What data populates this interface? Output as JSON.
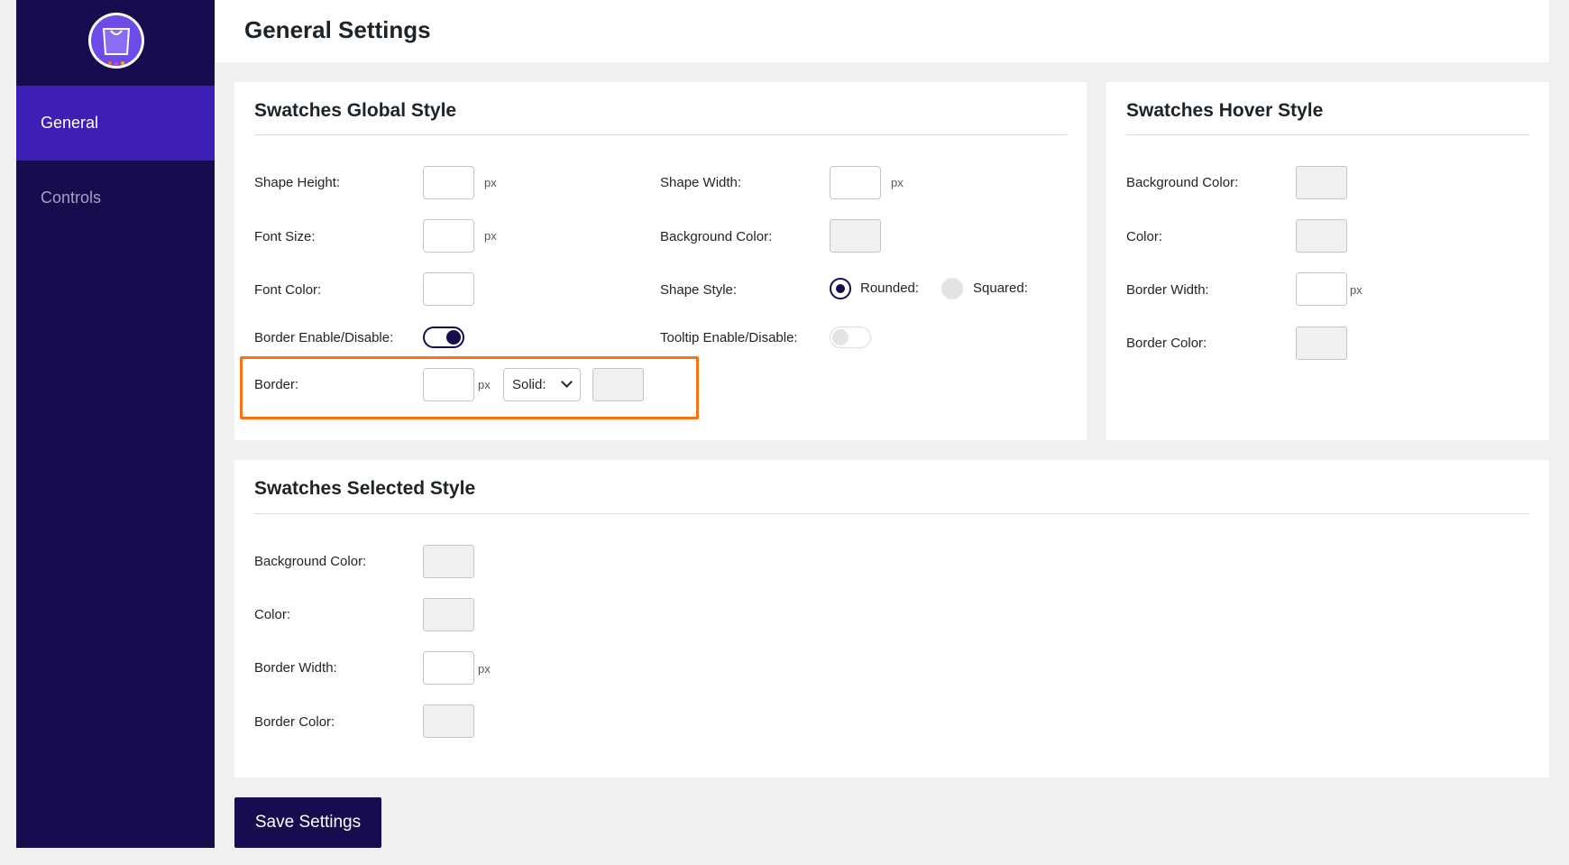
{
  "sidebar": {
    "logo_icon": "shopping-bag-icon",
    "items": [
      {
        "label": "General",
        "active": true
      },
      {
        "label": "Controls",
        "active": false
      }
    ]
  },
  "header": {
    "title": "General Settings"
  },
  "global_style": {
    "title": "Swatches Global Style",
    "shape_height": {
      "label": "Shape Height:",
      "value": "",
      "unit": "px"
    },
    "shape_width": {
      "label": "Shape Width:",
      "value": "",
      "unit": "px"
    },
    "font_size": {
      "label": "Font Size:",
      "value": "",
      "unit": "px"
    },
    "background_color": {
      "label": "Background Color:"
    },
    "font_color": {
      "label": "Font Color:"
    },
    "shape_style": {
      "label": "Shape Style:",
      "options": [
        "Rounded:",
        "Squared:"
      ],
      "selected": "Rounded:"
    },
    "border_toggle": {
      "label": "Border Enable/Disable:",
      "on": true
    },
    "tooltip_toggle": {
      "label": "Tooltip Enable/Disable:",
      "on": false
    },
    "border": {
      "label": "Border:",
      "value": "",
      "unit": "px",
      "style": "Solid:"
    }
  },
  "hover_style": {
    "title": "Swatches Hover Style",
    "background_color": {
      "label": "Background Color:"
    },
    "color": {
      "label": "Color:"
    },
    "border_width": {
      "label": "Border Width:",
      "value": "",
      "unit": "px"
    },
    "border_color": {
      "label": "Border Color:"
    }
  },
  "selected_style": {
    "title": "Swatches Selected Style",
    "background_color": {
      "label": "Background Color:"
    },
    "color": {
      "label": "Color:"
    },
    "border_width": {
      "label": "Border Width:",
      "value": "",
      "unit": "px"
    },
    "border_color": {
      "label": "Border Color:"
    }
  },
  "actions": {
    "save_label": "Save Settings"
  },
  "colors": {
    "sidebar_bg": "#170c4d",
    "active_nav": "#3d1fb5",
    "highlight": "#f97316"
  }
}
